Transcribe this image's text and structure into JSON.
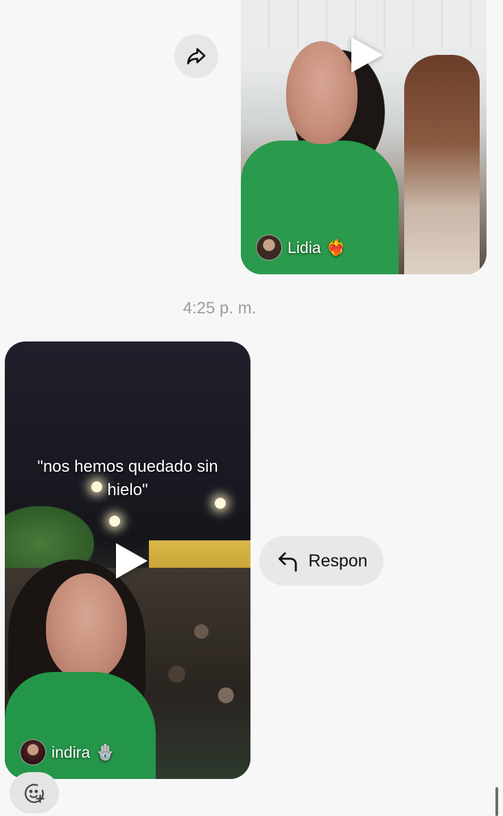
{
  "messages": [
    {
      "type": "video",
      "side": "right",
      "author": "Lidia",
      "author_emoji": "❤️‍🔥",
      "caption": ""
    },
    {
      "type": "video",
      "side": "left",
      "author": "indira",
      "author_emoji": "🪬",
      "caption": "\"nos hemos quedado sin hielo\""
    }
  ],
  "timestamp": "4:25 p. m.",
  "actions": {
    "reply_label": "Respon",
    "forward_icon": "forward-icon",
    "reply_icon": "reply-arrow-icon",
    "react_icon": "add-reaction-icon"
  },
  "colors": {
    "background": "#f7f7f7",
    "button_bg": "#e8e8e8",
    "timestamp": "#9c9c9c"
  }
}
